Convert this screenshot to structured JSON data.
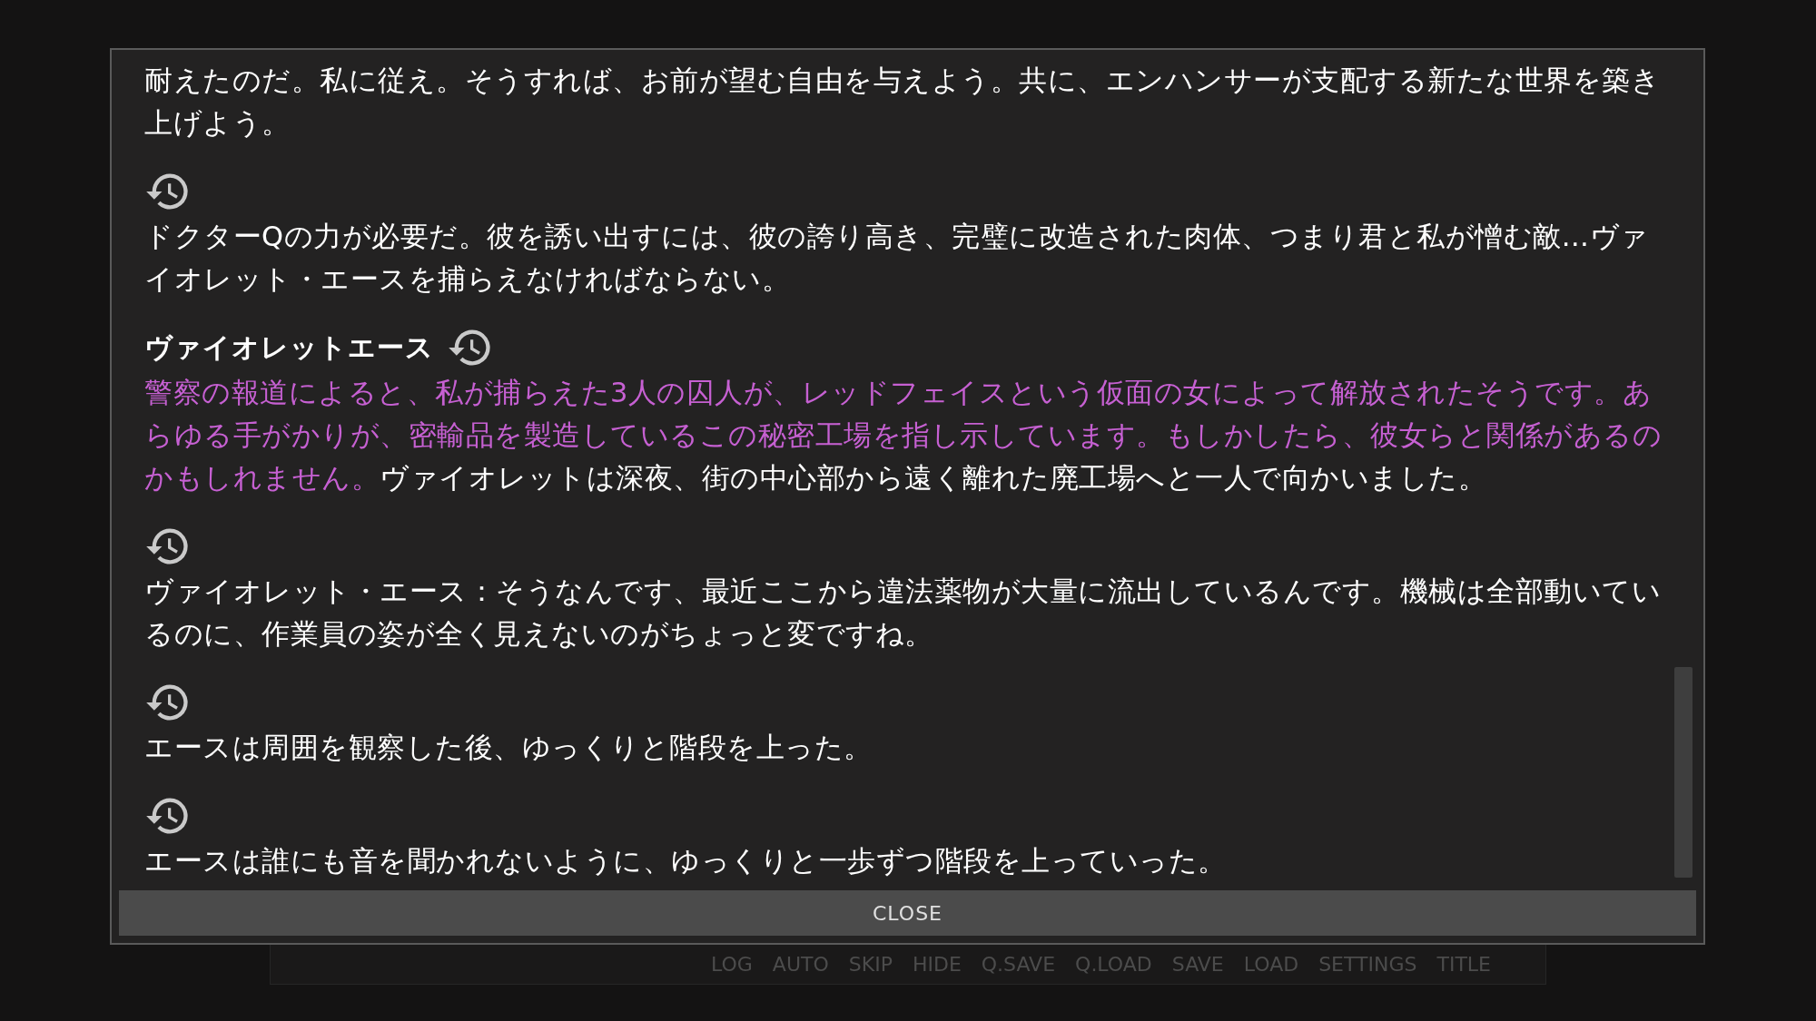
{
  "log_entries": [
    {
      "voice": false,
      "segments": [
        {
          "text": "耐えたのだ。私に従え。そうすれば、お前が望む自由を与えよう。共に、エンハンサーが支配する新たな世界を築き上げよう。",
          "color": "#ffffff"
        }
      ]
    },
    {
      "voice": true,
      "segments": [
        {
          "text": "ドクターQの力が必要だ。彼を誘い出すには、彼の誇り高き、完璧に改造された肉体、つまり君と私が憎む敵…ヴァイオレット・エースを捕らえなければならない。",
          "color": "#ffffff"
        }
      ]
    },
    {
      "speaker": "ヴァイオレットエース",
      "voice": true,
      "segments": [
        {
          "text": "警察の報道によると、私が捕らえた3人の囚人が、レッドフェイスという仮面の女によって解放されたそうです。あらゆる手がかりが、密輸品を製造しているこの秘密工場を指し示しています。もしかしたら、彼女らと関係があるのかもしれません。",
          "color": "#c660d2"
        },
        {
          "text": "ヴァイオレットは深夜、街の中心部から遠く離れた廃工場へと一人で向かいました。",
          "color": "#ffffff"
        }
      ]
    },
    {
      "voice": true,
      "segments": [
        {
          "text": "ヴァイオレット・エース：そうなんです、最近ここから違法薬物が大量に流出しているんです。機械は全部動いているのに、作業員の姿が全く見えないのがちょっと変ですね。",
          "color": "#ffffff"
        }
      ]
    },
    {
      "voice": true,
      "segments": [
        {
          "text": "エースは周囲を観察した後、ゆっくりと階段を上った。",
          "color": "#ffffff"
        }
      ]
    },
    {
      "voice": true,
      "segments": [
        {
          "text": "エースは誰にも音を聞かれないように、ゆっくりと一歩ずつ階段を上っていった。",
          "color": "#ffffff"
        }
      ]
    }
  ],
  "close_button": "CLOSE",
  "quick_menu": [
    "LOG",
    "AUTO",
    "SKIP",
    "HIDE",
    "Q.SAVE",
    "Q.LOAD",
    "SAVE",
    "LOAD",
    "SETTINGS",
    "TITLE"
  ]
}
